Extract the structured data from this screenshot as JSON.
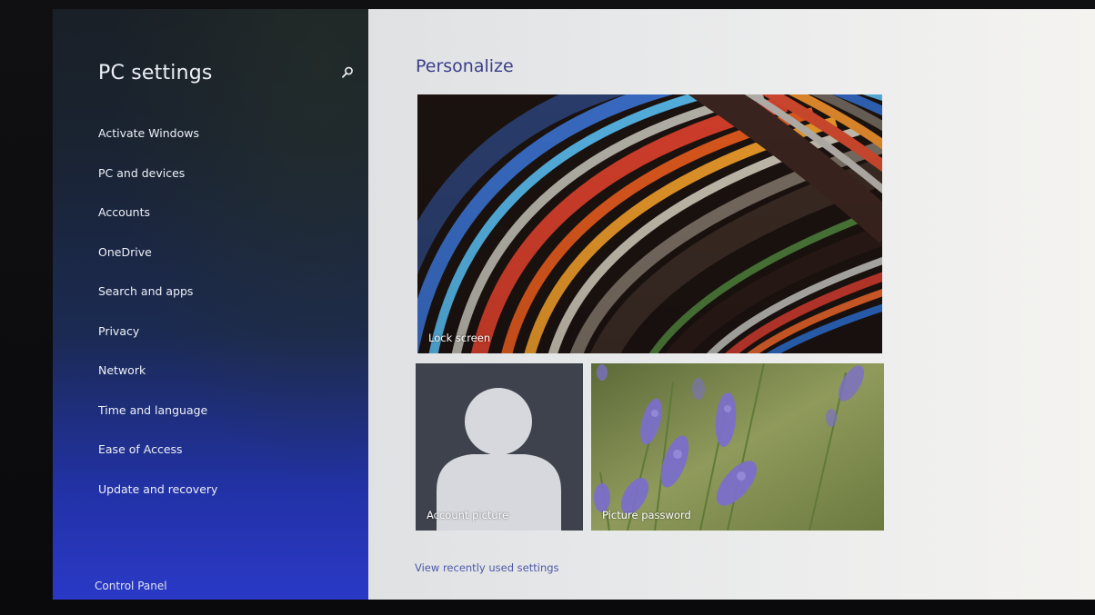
{
  "sidebar": {
    "title": "PC settings",
    "items": [
      {
        "label": "Activate Windows"
      },
      {
        "label": "PC and devices"
      },
      {
        "label": "Accounts"
      },
      {
        "label": "OneDrive"
      },
      {
        "label": "Search and apps"
      },
      {
        "label": "Privacy"
      },
      {
        "label": "Network"
      },
      {
        "label": "Time and language"
      },
      {
        "label": "Ease of Access"
      },
      {
        "label": "Update and recovery"
      }
    ],
    "footer_link": "Control Panel",
    "search_icon": "search-icon"
  },
  "main": {
    "title": "Personalize",
    "tiles": {
      "lock_screen": "Lock screen",
      "account_picture": "Account picture",
      "picture_password": "Picture password"
    },
    "recent_link": "View recently used settings"
  },
  "colors": {
    "sidebar_top": "#1a2027",
    "sidebar_bottom": "#2a39c6",
    "title_accent": "#3b3f8a",
    "link": "#4e5aa8",
    "content_bg": "#e8e9ea"
  }
}
